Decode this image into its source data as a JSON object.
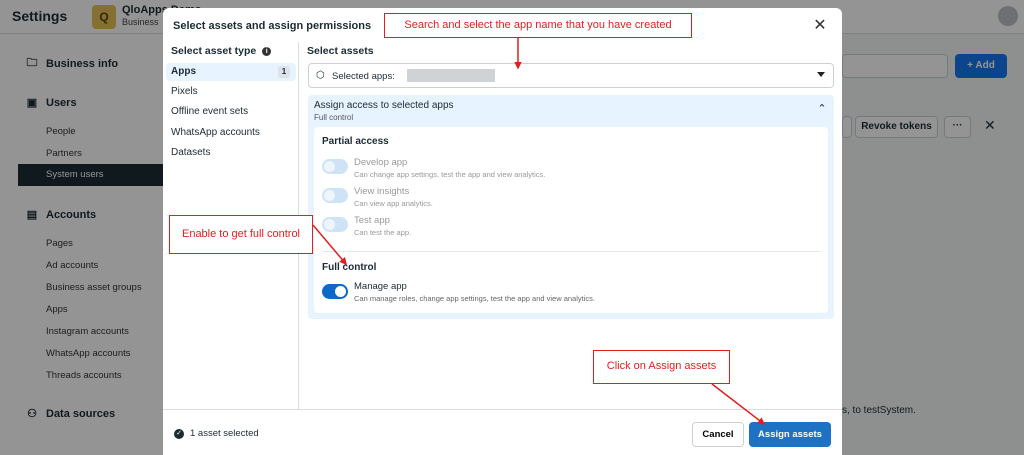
{
  "background": {
    "app_title": "Settings",
    "business": {
      "initial": "Q",
      "name": "QloApps Demo",
      "sub": "Business"
    },
    "nav": {
      "business_info": "Business info",
      "users": "Users",
      "users_items": [
        "People",
        "Partners",
        "System users"
      ],
      "accounts": "Accounts",
      "accounts_items": [
        "Pages",
        "Ad accounts",
        "Business asset groups",
        "Apps",
        "Instagram accounts",
        "WhatsApp accounts",
        "Threads accounts"
      ],
      "data_sources": "Data sources"
    },
    "add_button": "+ Add",
    "revoke_button": "Revoke tokens",
    "more_button": "···",
    "footer_text": "s, to testSystem."
  },
  "modal": {
    "title": "Select assets and assign permissions",
    "asset_type_header": "Select asset type",
    "asset_types": [
      {
        "label": "Apps",
        "count": "1"
      },
      {
        "label": "Pixels"
      },
      {
        "label": "Offline event sets"
      },
      {
        "label": "WhatsApp accounts"
      },
      {
        "label": "Datasets"
      }
    ],
    "assets_header": "Select assets",
    "select_label": "Selected apps:",
    "access": {
      "title": "Assign access to selected apps",
      "subtitle": "Full control",
      "partial_title": "Partial access",
      "partial": [
        {
          "name": "Develop app",
          "desc": "Can change app settings, test the app and view analytics."
        },
        {
          "name": "View insights",
          "desc": "Can view app analytics."
        },
        {
          "name": "Test app",
          "desc": "Can test the app."
        }
      ],
      "full_title": "Full control",
      "full": {
        "name": "Manage app",
        "desc": "Can manage roles, change app settings, test the app and view analytics."
      }
    },
    "footer": {
      "status": "1 asset selected",
      "cancel": "Cancel",
      "assign": "Assign assets"
    }
  },
  "callouts": {
    "search": "Search and select the app name that you have created",
    "enable": "Enable to get full control",
    "assign": "Click on Assign assets"
  },
  "colors": {
    "primary": "#1d72c4",
    "callout": "#e02020",
    "selected_bg": "#e7f3ff"
  }
}
